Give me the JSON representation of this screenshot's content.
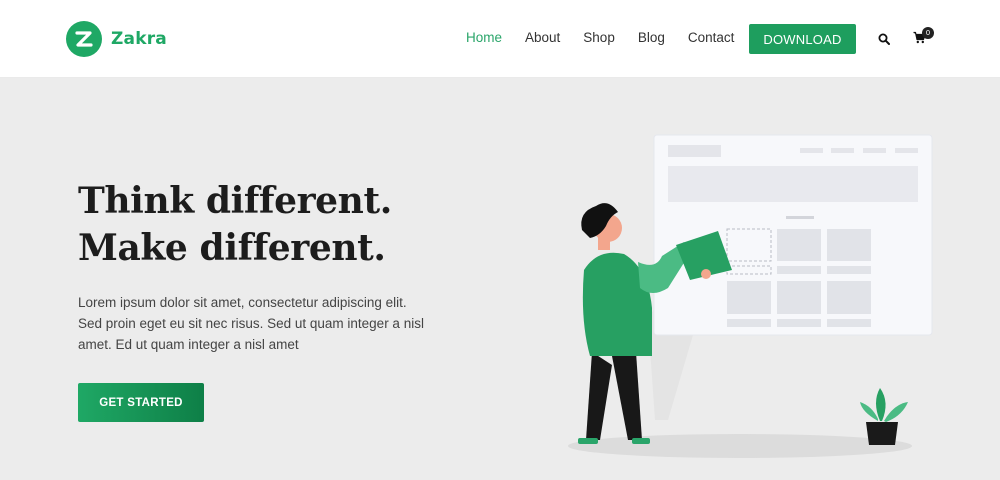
{
  "brand": {
    "name": "Zakra"
  },
  "nav": {
    "items": [
      {
        "label": "Home",
        "active": true
      },
      {
        "label": "About",
        "active": false
      },
      {
        "label": "Shop",
        "active": false
      },
      {
        "label": "Blog",
        "active": false
      },
      {
        "label": "Contact",
        "active": false
      }
    ],
    "download_label": "DOWNLOAD",
    "cart_count": "0"
  },
  "hero": {
    "headline_line1": "Think different.",
    "headline_line2": "Make different.",
    "paragraph_line1": "Lorem ipsum dolor sit amet, consectetur adipiscing elit.",
    "paragraph_line2": "Sed proin eget eu sit nec risus. Sed ut quam integer a nisl",
    "paragraph_line3": "amet.  Ed ut quam integer a nisl amet",
    "cta_label": "GET STARTED"
  },
  "icons": [
    "zakra-logo-icon",
    "search-icon",
    "cart-icon"
  ],
  "colors": {
    "accent": "#1fa865",
    "accent_dark": "#0e7f47",
    "hero_bg": "#ececec",
    "nav_active": "#2aa56a"
  }
}
